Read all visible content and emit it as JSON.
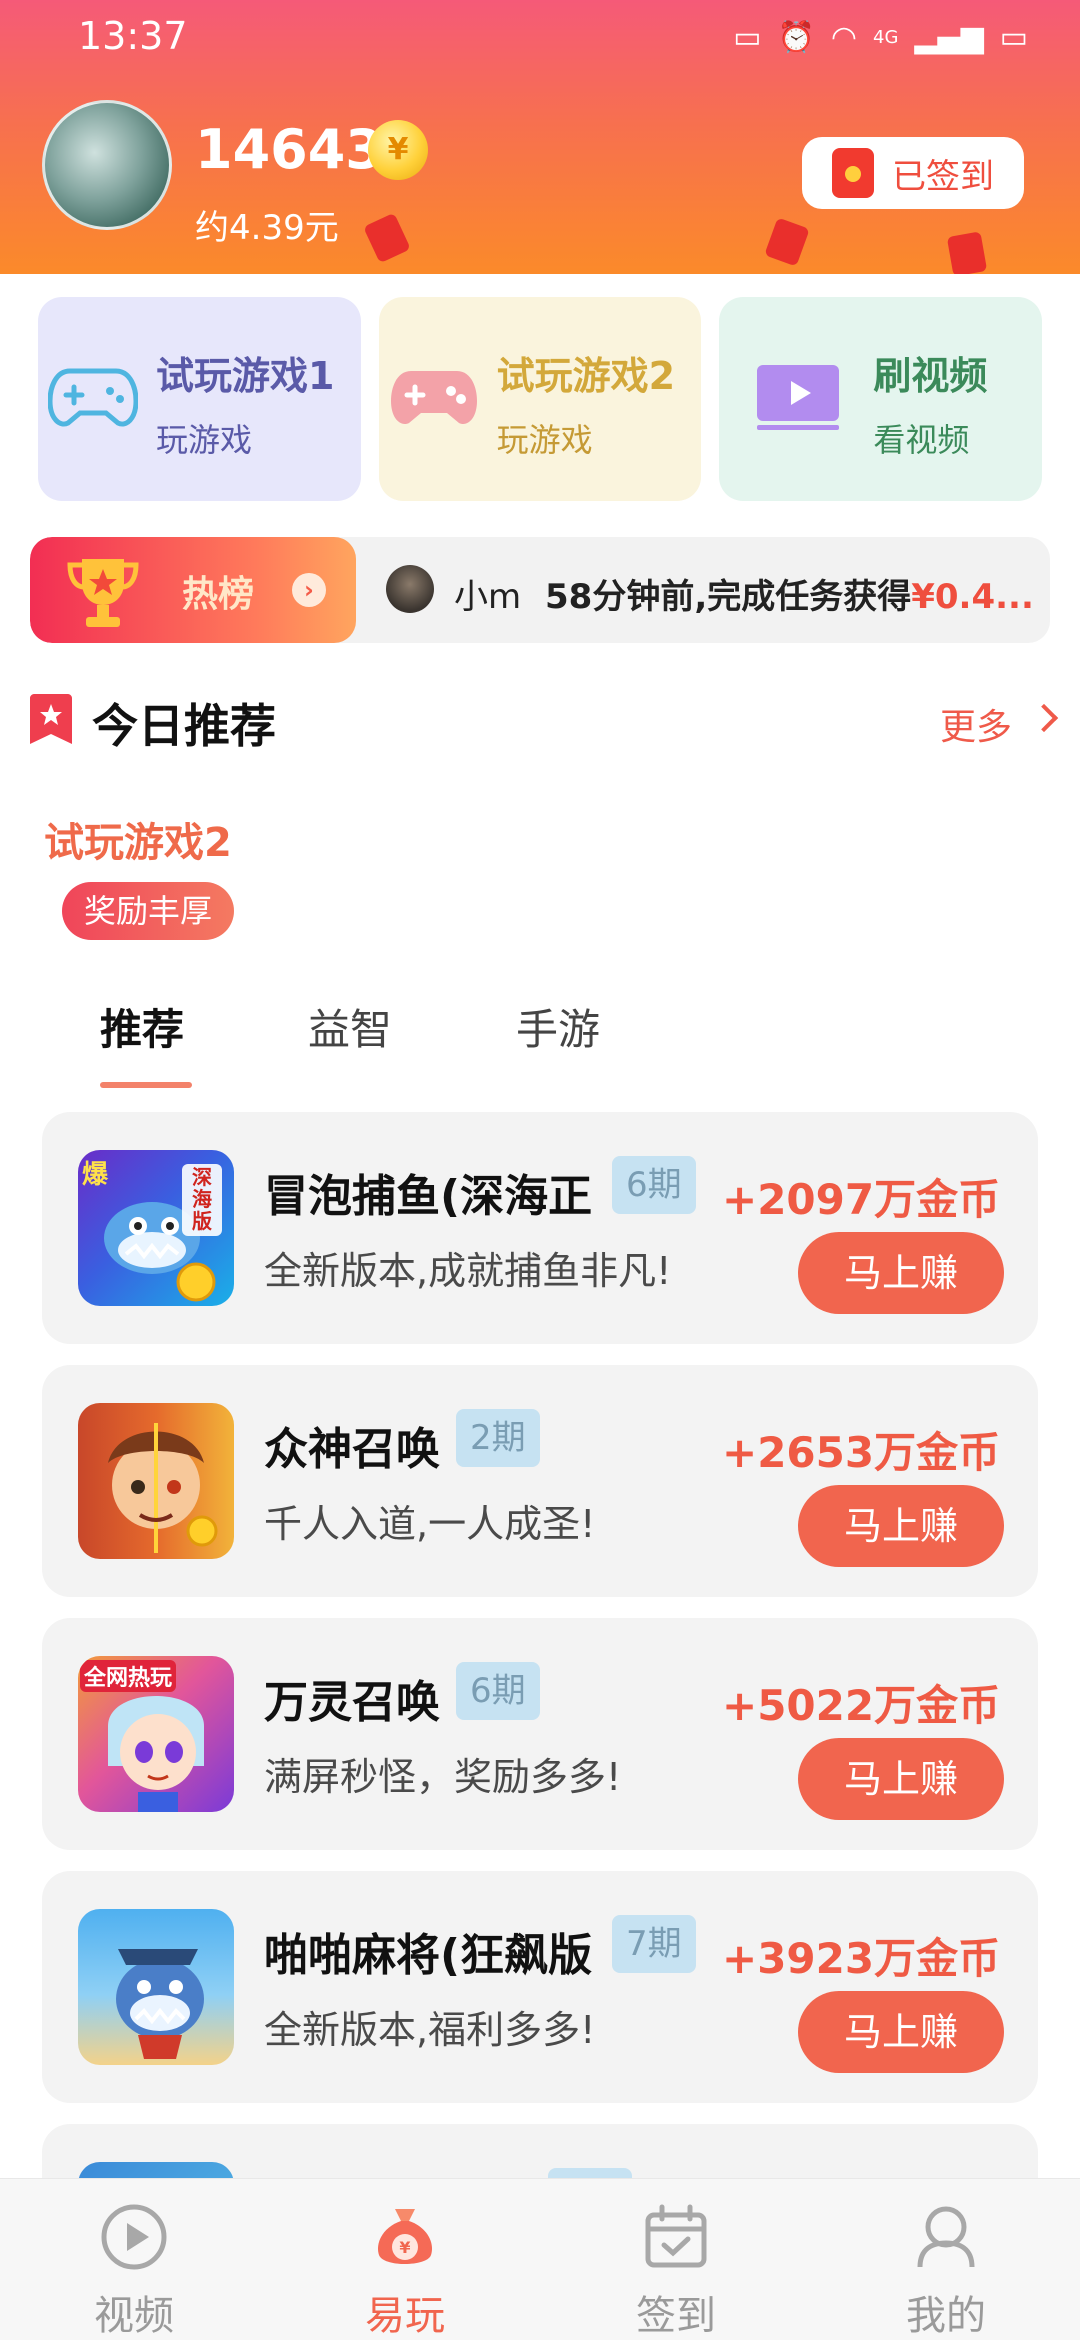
{
  "status_bar": {
    "time": "13:37",
    "network": "4G"
  },
  "header": {
    "coins": "14643",
    "coin_symbol": "¥",
    "cash_estimate": "约4.39元",
    "signin_label": "已签到"
  },
  "feature_cards": [
    {
      "title": "试玩游戏1",
      "subtitle": "玩游戏",
      "icon": "gamepad-icon"
    },
    {
      "title": "试玩游戏2",
      "subtitle": "玩游戏",
      "icon": "gamepad-icon"
    },
    {
      "title": "刷视频",
      "subtitle": "看视频",
      "icon": "video-icon"
    }
  ],
  "hot_ticker": {
    "label": "热榜",
    "arrow": "›",
    "user": "小m",
    "message": "58分钟前,完成任务获得",
    "amount": "¥0.4..."
  },
  "section": {
    "title": "今日推荐",
    "more": "更多"
  },
  "recommend": {
    "title": "试玩游戏2",
    "badge": "奖励丰厚"
  },
  "tabs": [
    {
      "label": "推荐",
      "active": true
    },
    {
      "label": "益智",
      "active": false
    },
    {
      "label": "手游",
      "active": false
    }
  ],
  "games": [
    {
      "name": "冒泡捕鱼(深海正",
      "period": "6期",
      "reward": "+2097万金币",
      "desc": "全新版本,成就捕鱼非凡!",
      "button": "马上赚",
      "icon_label_a": "爆",
      "icon_label_b": "深海版"
    },
    {
      "name": "众神召唤",
      "period": "2期",
      "reward": "+2653万金币",
      "desc": "千人入道,一人成圣!",
      "button": "马上赚"
    },
    {
      "name": "万灵召唤",
      "period": "6期",
      "reward": "+5022万金币",
      "desc": "满屏秒怪，奖励多多!",
      "button": "马上赚",
      "icon_label_a": "全网热玩"
    },
    {
      "name": "啪啪麻将(狂飙版",
      "period": "7期",
      "reward": "+3923万金币",
      "desc": "全新版本,福利多多!",
      "button": "马上赚"
    }
  ],
  "bottom_nav": [
    {
      "label": "视频",
      "active": false
    },
    {
      "label": "易玩",
      "active": true
    },
    {
      "label": "签到",
      "active": false
    },
    {
      "label": "我的",
      "active": false
    }
  ],
  "colors": {
    "accent": "#f1654e",
    "header_top": "#f55a78",
    "header_bottom": "#fb8a2a"
  }
}
